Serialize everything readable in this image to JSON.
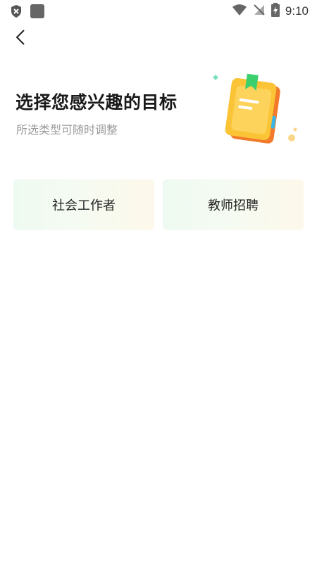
{
  "status_bar": {
    "time": "9:10",
    "icons": [
      "shield-x-icon",
      "app-square-icon",
      "wifi-icon",
      "no-signal-icon",
      "battery-charging-icon"
    ]
  },
  "nav": {
    "back_icon": "chevron-left-icon"
  },
  "header": {
    "title": "选择您感兴趣的目标",
    "subtitle": "所选类型可随时调整",
    "illustration": "book-icon"
  },
  "goals": [
    {
      "label": "社会工作者"
    },
    {
      "label": "教师招聘"
    }
  ],
  "colors": {
    "card_gradient_start": "#eefaf1",
    "card_gradient_end": "#fdf8ea",
    "book_yellow": "#f9b92e",
    "bookmark_green": "#3ccf6e"
  }
}
